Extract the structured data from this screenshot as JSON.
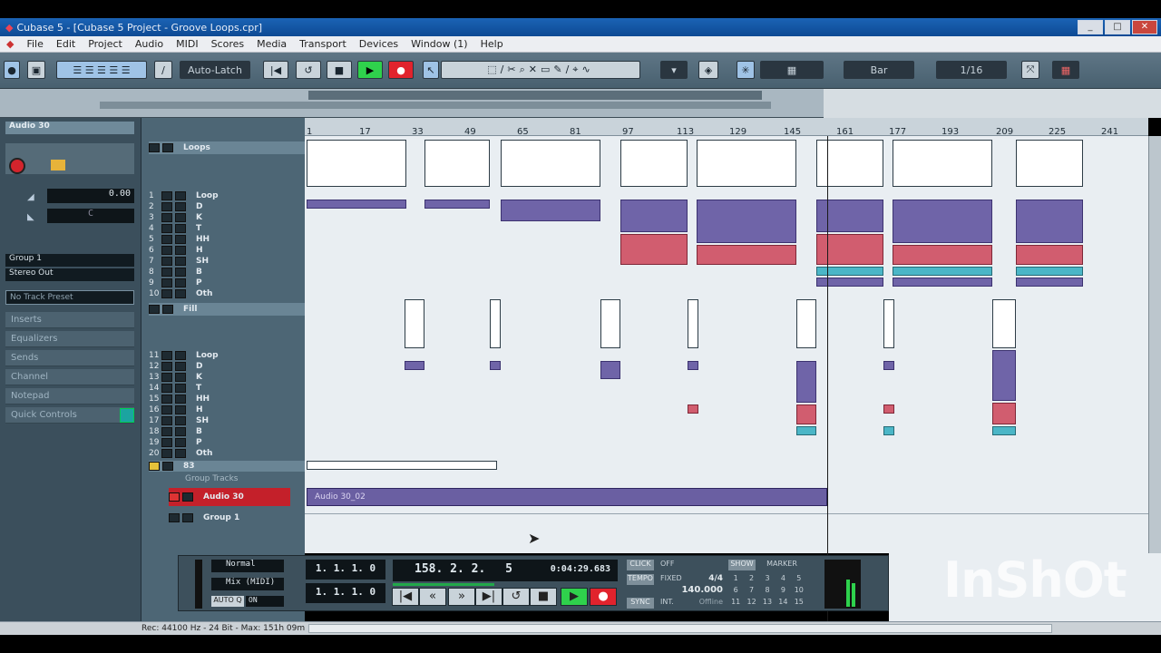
{
  "window": {
    "title": "Cubase 5 - [Cubase 5 Project - Groove Loops.cpr]"
  },
  "menu": [
    "File",
    "Edit",
    "Project",
    "Audio",
    "MIDI",
    "Scores",
    "Media",
    "Transport",
    "Devices",
    "Window (1)",
    "Help"
  ],
  "toolbar": {
    "automation_mode": "Auto-Latch",
    "snap_type": "Bar",
    "quantize": "1/16"
  },
  "ruler": {
    "ticks": [
      "1",
      "17",
      "33",
      "49",
      "65",
      "81",
      "97",
      "113",
      "129",
      "145",
      "161",
      "177",
      "193",
      "209",
      "225",
      "241"
    ]
  },
  "inspector": {
    "track_name": "Audio 30",
    "volume": "0.00",
    "pan": "C",
    "input": "Group 1",
    "output": "Stereo Out",
    "preset": "No Track Preset",
    "sections": [
      "Inserts",
      "Equalizers",
      "Sends",
      "Channel",
      "Notepad",
      "Quick Controls"
    ]
  },
  "tracks": {
    "folder1": "Loops",
    "group1": [
      {
        "n": "1",
        "name": "Loop"
      },
      {
        "n": "2",
        "name": "D"
      },
      {
        "n": "3",
        "name": "K"
      },
      {
        "n": "4",
        "name": "T"
      },
      {
        "n": "5",
        "name": "HH"
      },
      {
        "n": "6",
        "name": "H"
      },
      {
        "n": "7",
        "name": "SH"
      },
      {
        "n": "8",
        "name": "B"
      },
      {
        "n": "9",
        "name": "P"
      },
      {
        "n": "10",
        "name": "Oth"
      }
    ],
    "folder2": "Fill",
    "group2": [
      {
        "n": "11",
        "name": "Loop"
      },
      {
        "n": "12",
        "name": "D"
      },
      {
        "n": "13",
        "name": "K"
      },
      {
        "n": "14",
        "name": "T"
      },
      {
        "n": "15",
        "name": "HH"
      },
      {
        "n": "16",
        "name": "H"
      },
      {
        "n": "17",
        "name": "SH"
      },
      {
        "n": "18",
        "name": "B"
      },
      {
        "n": "19",
        "name": "P"
      },
      {
        "n": "20",
        "name": "Oth"
      }
    ],
    "track21": "83",
    "group_folder": "Group Tracks",
    "audio": "Audio 30",
    "group": "Group 1"
  },
  "audio_part": {
    "label": "Audio 30_02"
  },
  "transport": {
    "mode": "Normal",
    "mix": "Mix (MIDI)",
    "auto_q": "AUTO Q",
    "auto_q_state": "ON",
    "left_locator": "1. 1. 1. 0",
    "right_locator": "1. 1. 1. 0",
    "position_bars": "158. 2. 2.",
    "position_ticks": "5",
    "position_time": "0:04:29.683",
    "click": "CLICK",
    "click_state": "OFF",
    "tempo_label": "TEMPO",
    "tempo_mode": "FIXED",
    "signature": "4/4",
    "tempo": "140.000",
    "sync": "SYNC",
    "sync_mode": "INT.",
    "sync_state": "Offline",
    "show": "SHOW",
    "marker": "MARKER",
    "markers": [
      "1",
      "2",
      "3",
      "4",
      "5",
      "6",
      "7",
      "8",
      "9",
      "10",
      "11",
      "12",
      "13",
      "14",
      "15"
    ]
  },
  "status": {
    "text": "Rec: 44100 Hz - 24 Bit - Max: 151h 09m"
  },
  "watermark": "InShOt",
  "colors": {
    "midi_purple": "#6f64a8",
    "midi_red": "#d15d6f",
    "midi_cyan": "#4bb6c7",
    "audio_part": "#6a5fa2",
    "selected_track": "#c4202a"
  }
}
